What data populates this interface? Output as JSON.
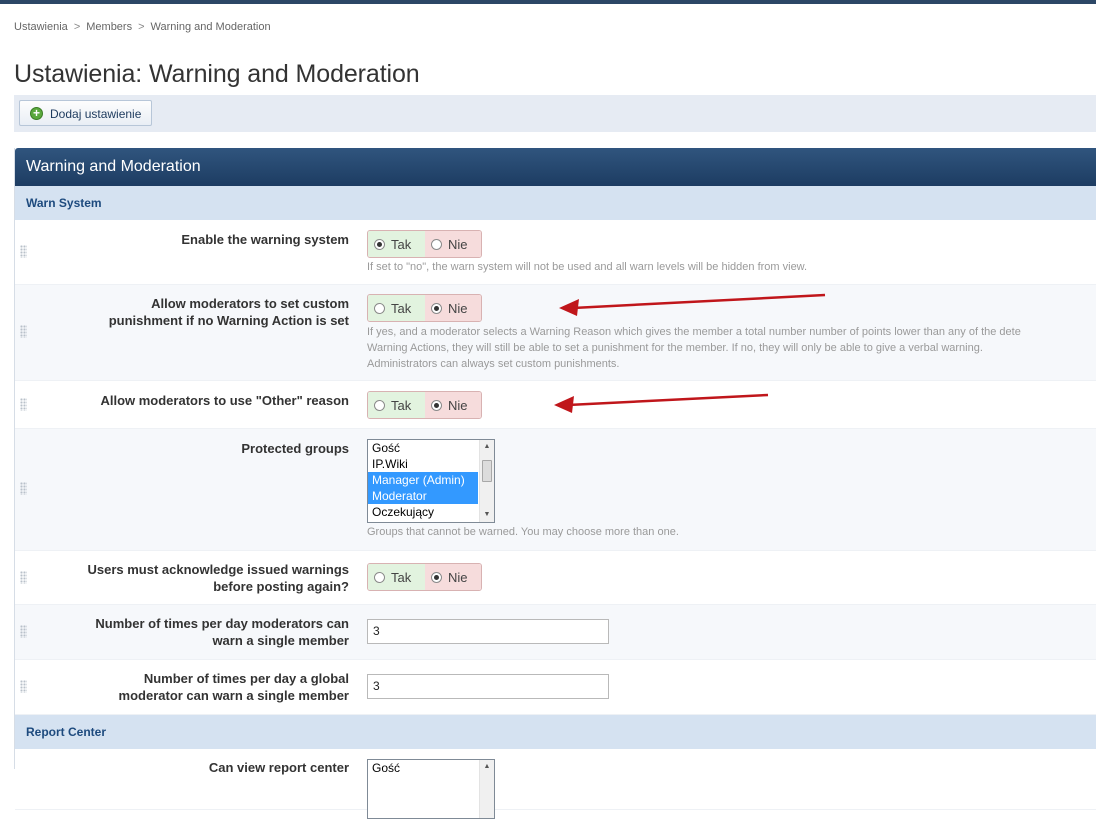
{
  "breadcrumb": [
    "Ustawienia",
    "Members",
    "Warning and Moderation"
  ],
  "breadcrumb_sep": ">",
  "page_title": "Ustawienia: Warning and Moderation",
  "toolbar": {
    "add_label": "Dodaj ustawienie"
  },
  "panel": {
    "title": "Warning and Moderation",
    "section1": "Warn System",
    "section2": "Report Center"
  },
  "yes_label": "Tak",
  "no_label": "Nie",
  "settings": {
    "enable_warn": {
      "label": "Enable the warning system",
      "value": "Tak",
      "desc": "If set to \"no\", the warn system will not be used and all warn levels will be hidden from view."
    },
    "custom_punish": {
      "label_line1": "Allow moderators to set custom",
      "label_line2": "punishment if no Warning Action is set",
      "value": "Nie",
      "desc_line1": "If yes, and a moderator selects a Warning Reason which gives the member a total number number of points lower than any of the dete",
      "desc_line2": "Warning Actions, they will still be able to set a punishment for the member. If no, they will only be able to give a verbal warning.",
      "desc_line3": "Administrators can always set custom punishments."
    },
    "other_reason": {
      "label": "Allow moderators to use \"Other\" reason",
      "value": "Nie"
    },
    "protected_groups": {
      "label": "Protected groups",
      "options": [
        "Gość",
        "IP.Wiki",
        "Manager (Admin)",
        "Moderator",
        "Oczekujący"
      ],
      "selected": [
        "Manager (Admin)",
        "Moderator"
      ],
      "desc": "Groups that cannot be warned. You may choose more than one."
    },
    "acknowledge": {
      "label_line1": "Users must acknowledge issued warnings",
      "label_line2": "before posting again?",
      "value": "Nie"
    },
    "mod_warn_per_day": {
      "label_line1": "Number of times per day moderators can",
      "label_line2": "warn a single member",
      "value": "3"
    },
    "gmod_warn_per_day": {
      "label_line1": "Number of times per day a global",
      "label_line2": "moderator can warn a single member",
      "value": "3"
    },
    "view_report": {
      "label": "Can view report center",
      "first_option": "Gość"
    }
  },
  "colors": {
    "header": "#1d3c62",
    "section": "#d5e2f1",
    "arrow": "#c0161b"
  }
}
